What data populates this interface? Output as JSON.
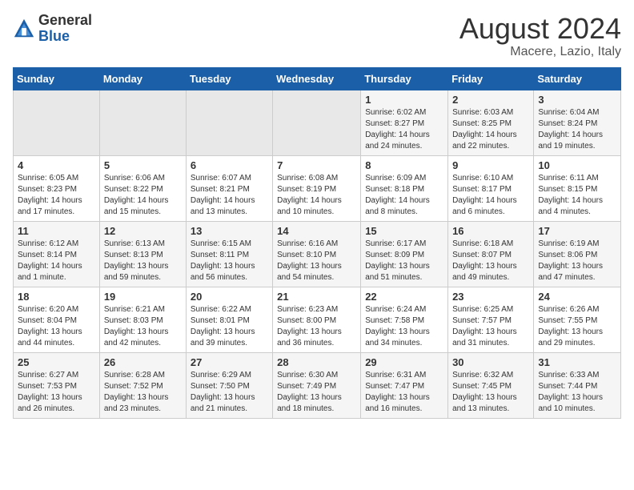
{
  "header": {
    "logo_general": "General",
    "logo_blue": "Blue",
    "title": "August 2024",
    "subtitle": "Macere, Lazio, Italy"
  },
  "days_of_week": [
    "Sunday",
    "Monday",
    "Tuesday",
    "Wednesday",
    "Thursday",
    "Friday",
    "Saturday"
  ],
  "weeks": [
    [
      {
        "day": "",
        "empty": true
      },
      {
        "day": "",
        "empty": true
      },
      {
        "day": "",
        "empty": true
      },
      {
        "day": "",
        "empty": true
      },
      {
        "day": "1",
        "sunrise": "6:02 AM",
        "sunset": "8:27 PM",
        "daylight": "14 hours and 24 minutes."
      },
      {
        "day": "2",
        "sunrise": "6:03 AM",
        "sunset": "8:25 PM",
        "daylight": "14 hours and 22 minutes."
      },
      {
        "day": "3",
        "sunrise": "6:04 AM",
        "sunset": "8:24 PM",
        "daylight": "14 hours and 19 minutes."
      }
    ],
    [
      {
        "day": "4",
        "sunrise": "6:05 AM",
        "sunset": "8:23 PM",
        "daylight": "14 hours and 17 minutes."
      },
      {
        "day": "5",
        "sunrise": "6:06 AM",
        "sunset": "8:22 PM",
        "daylight": "14 hours and 15 minutes."
      },
      {
        "day": "6",
        "sunrise": "6:07 AM",
        "sunset": "8:21 PM",
        "daylight": "14 hours and 13 minutes."
      },
      {
        "day": "7",
        "sunrise": "6:08 AM",
        "sunset": "8:19 PM",
        "daylight": "14 hours and 10 minutes."
      },
      {
        "day": "8",
        "sunrise": "6:09 AM",
        "sunset": "8:18 PM",
        "daylight": "14 hours and 8 minutes."
      },
      {
        "day": "9",
        "sunrise": "6:10 AM",
        "sunset": "8:17 PM",
        "daylight": "14 hours and 6 minutes."
      },
      {
        "day": "10",
        "sunrise": "6:11 AM",
        "sunset": "8:15 PM",
        "daylight": "14 hours and 4 minutes."
      }
    ],
    [
      {
        "day": "11",
        "sunrise": "6:12 AM",
        "sunset": "8:14 PM",
        "daylight": "14 hours and 1 minute."
      },
      {
        "day": "12",
        "sunrise": "6:13 AM",
        "sunset": "8:13 PM",
        "daylight": "13 hours and 59 minutes."
      },
      {
        "day": "13",
        "sunrise": "6:15 AM",
        "sunset": "8:11 PM",
        "daylight": "13 hours and 56 minutes."
      },
      {
        "day": "14",
        "sunrise": "6:16 AM",
        "sunset": "8:10 PM",
        "daylight": "13 hours and 54 minutes."
      },
      {
        "day": "15",
        "sunrise": "6:17 AM",
        "sunset": "8:09 PM",
        "daylight": "13 hours and 51 minutes."
      },
      {
        "day": "16",
        "sunrise": "6:18 AM",
        "sunset": "8:07 PM",
        "daylight": "13 hours and 49 minutes."
      },
      {
        "day": "17",
        "sunrise": "6:19 AM",
        "sunset": "8:06 PM",
        "daylight": "13 hours and 47 minutes."
      }
    ],
    [
      {
        "day": "18",
        "sunrise": "6:20 AM",
        "sunset": "8:04 PM",
        "daylight": "13 hours and 44 minutes."
      },
      {
        "day": "19",
        "sunrise": "6:21 AM",
        "sunset": "8:03 PM",
        "daylight": "13 hours and 42 minutes."
      },
      {
        "day": "20",
        "sunrise": "6:22 AM",
        "sunset": "8:01 PM",
        "daylight": "13 hours and 39 minutes."
      },
      {
        "day": "21",
        "sunrise": "6:23 AM",
        "sunset": "8:00 PM",
        "daylight": "13 hours and 36 minutes."
      },
      {
        "day": "22",
        "sunrise": "6:24 AM",
        "sunset": "7:58 PM",
        "daylight": "13 hours and 34 minutes."
      },
      {
        "day": "23",
        "sunrise": "6:25 AM",
        "sunset": "7:57 PM",
        "daylight": "13 hours and 31 minutes."
      },
      {
        "day": "24",
        "sunrise": "6:26 AM",
        "sunset": "7:55 PM",
        "daylight": "13 hours and 29 minutes."
      }
    ],
    [
      {
        "day": "25",
        "sunrise": "6:27 AM",
        "sunset": "7:53 PM",
        "daylight": "13 hours and 26 minutes."
      },
      {
        "day": "26",
        "sunrise": "6:28 AM",
        "sunset": "7:52 PM",
        "daylight": "13 hours and 23 minutes."
      },
      {
        "day": "27",
        "sunrise": "6:29 AM",
        "sunset": "7:50 PM",
        "daylight": "13 hours and 21 minutes."
      },
      {
        "day": "28",
        "sunrise": "6:30 AM",
        "sunset": "7:49 PM",
        "daylight": "13 hours and 18 minutes."
      },
      {
        "day": "29",
        "sunrise": "6:31 AM",
        "sunset": "7:47 PM",
        "daylight": "13 hours and 16 minutes."
      },
      {
        "day": "30",
        "sunrise": "6:32 AM",
        "sunset": "7:45 PM",
        "daylight": "13 hours and 13 minutes."
      },
      {
        "day": "31",
        "sunrise": "6:33 AM",
        "sunset": "7:44 PM",
        "daylight": "13 hours and 10 minutes."
      }
    ]
  ]
}
